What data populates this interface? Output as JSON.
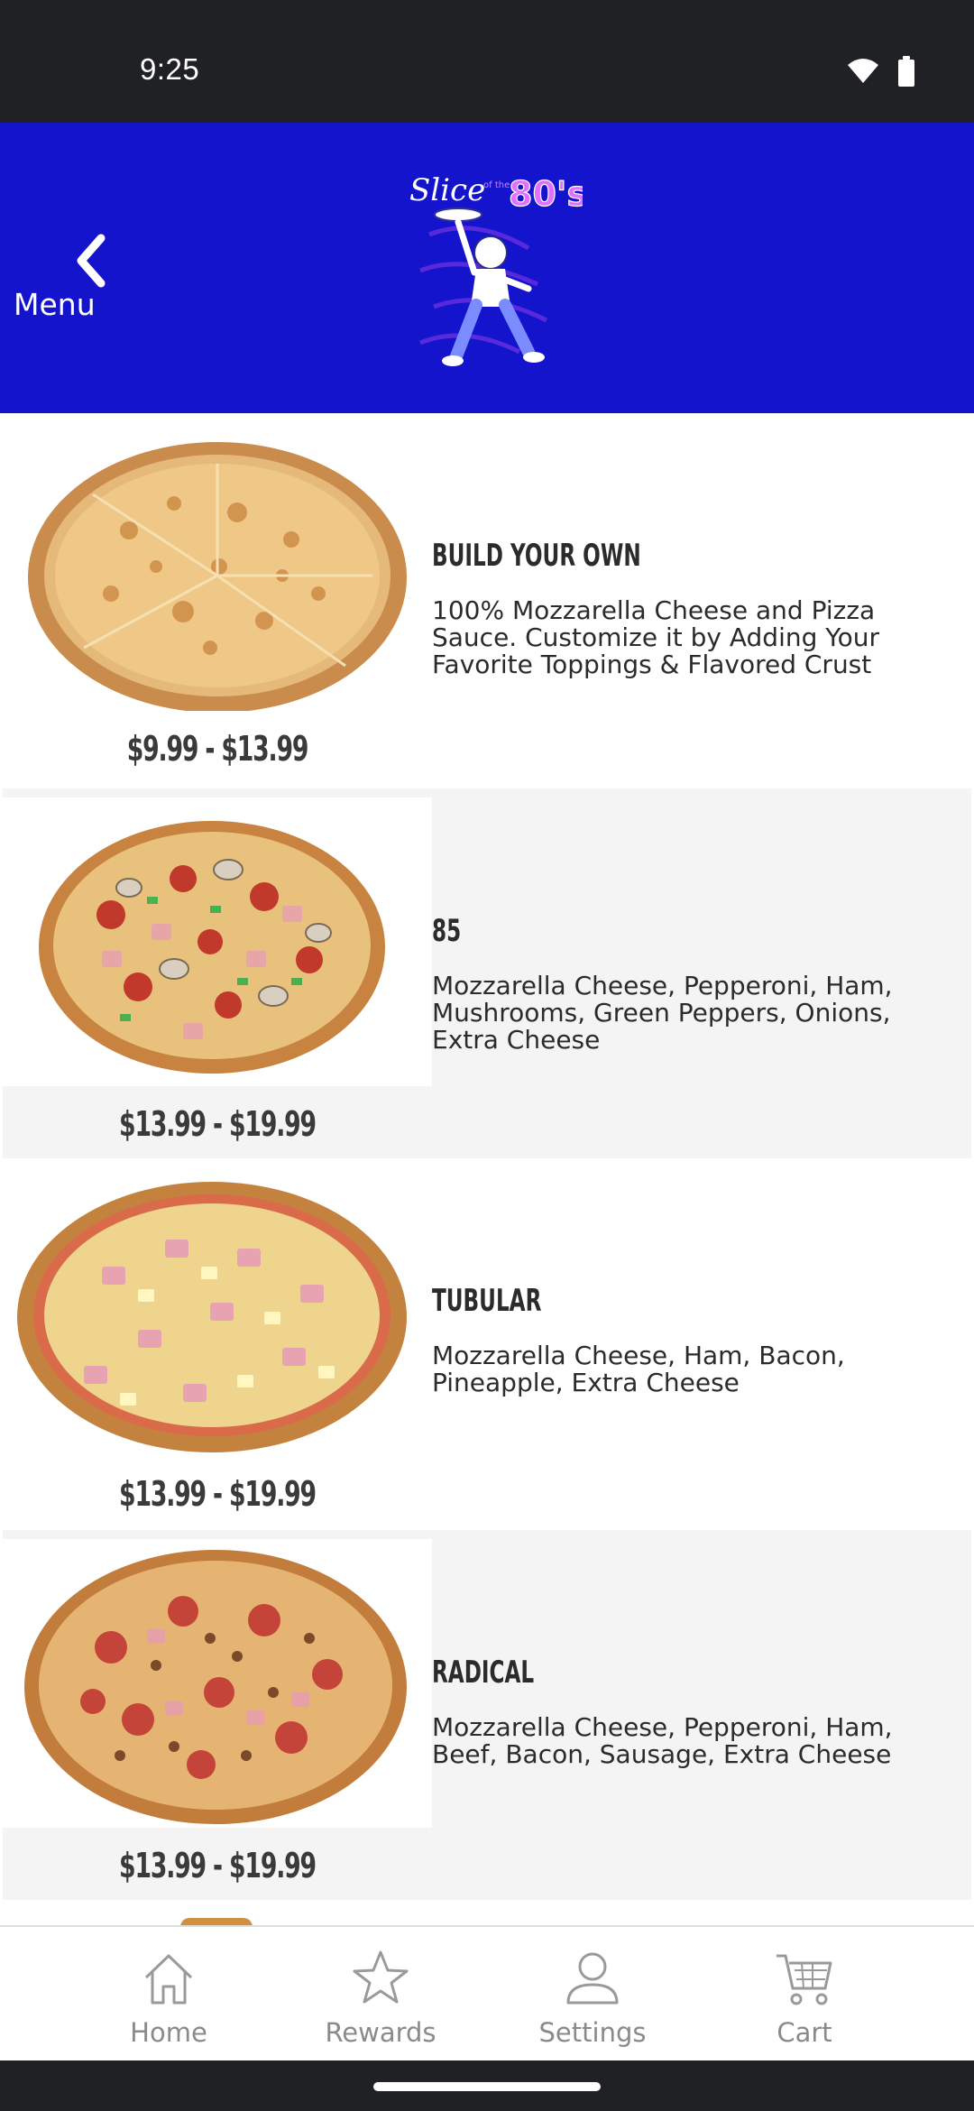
{
  "status_bar": {
    "time": "9:25",
    "icons": [
      "wifi-icon",
      "battery-icon"
    ]
  },
  "header": {
    "back_label": "Menu",
    "logo_text": "Slice of the 80's",
    "background_color": "#1414cc"
  },
  "menu_items": [
    {
      "name": "BUILD YOUR OWN",
      "description": "100% Mozzarella Cheese and Pizza Sauce. Customize it by Adding Your Favorite Toppings & Flavored Crust",
      "price": "$9.99 - $13.99",
      "image": "cheese-pizza-image"
    },
    {
      "name": "85",
      "description": "Mozzarella Cheese, Pepperoni, Ham, Mushrooms, Green Peppers, Onions, Extra Cheese",
      "price": "$13.99 - $19.99",
      "image": "supreme-pizza-image"
    },
    {
      "name": "TUBULAR",
      "description": "Mozzarella Cheese, Ham, Bacon, Pineapple, Extra Cheese",
      "price": "$13.99 - $19.99",
      "image": "hawaiian-pizza-image"
    },
    {
      "name": "RADICAL",
      "description": "Mozzarella Cheese, Pepperoni, Ham, Beef, Bacon, Sausage, Extra Cheese",
      "price": "$13.99 - $19.99",
      "image": "meat-pizza-image"
    }
  ],
  "bottom_nav": [
    {
      "label": "Home",
      "icon": "home-icon"
    },
    {
      "label": "Rewards",
      "icon": "star-icon"
    },
    {
      "label": "Settings",
      "icon": "person-icon"
    },
    {
      "label": "Cart",
      "icon": "cart-icon"
    }
  ]
}
